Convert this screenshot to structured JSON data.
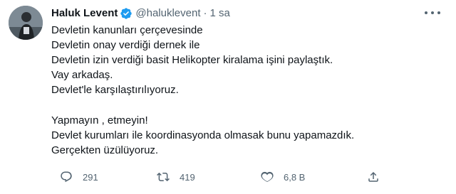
{
  "tweet": {
    "author_name": "Haluk Levent",
    "handle": "@haluklevent",
    "separator": "·",
    "time": "1 sa",
    "verified_color": "#1d9bf0",
    "lines": [
      "Devletin kanunları çerçevesinde",
      "Devletin onay verdiği dernek ile",
      "Devletin izin verdiği basit Helikopter kiralama işini paylaştık.",
      "Vay arkadaş.",
      "Devlet'le karşılaştırılıyoruz.",
      "Yapmayın , etmeyin!",
      "Devlet kurumları ile koordinasyonda olmasak bunu yapamazdık.",
      "Gerçekten üzülüyoruz."
    ]
  },
  "actions": {
    "reply_count": "291",
    "retweet_count": "419",
    "like_count": "6,8 B"
  },
  "icons": {
    "avatar": "avatar-photo",
    "verified": "verified-badge-icon",
    "more": "more-options-icon",
    "reply": "reply-icon",
    "retweet": "retweet-icon",
    "like": "heart-icon",
    "share": "share-icon"
  }
}
